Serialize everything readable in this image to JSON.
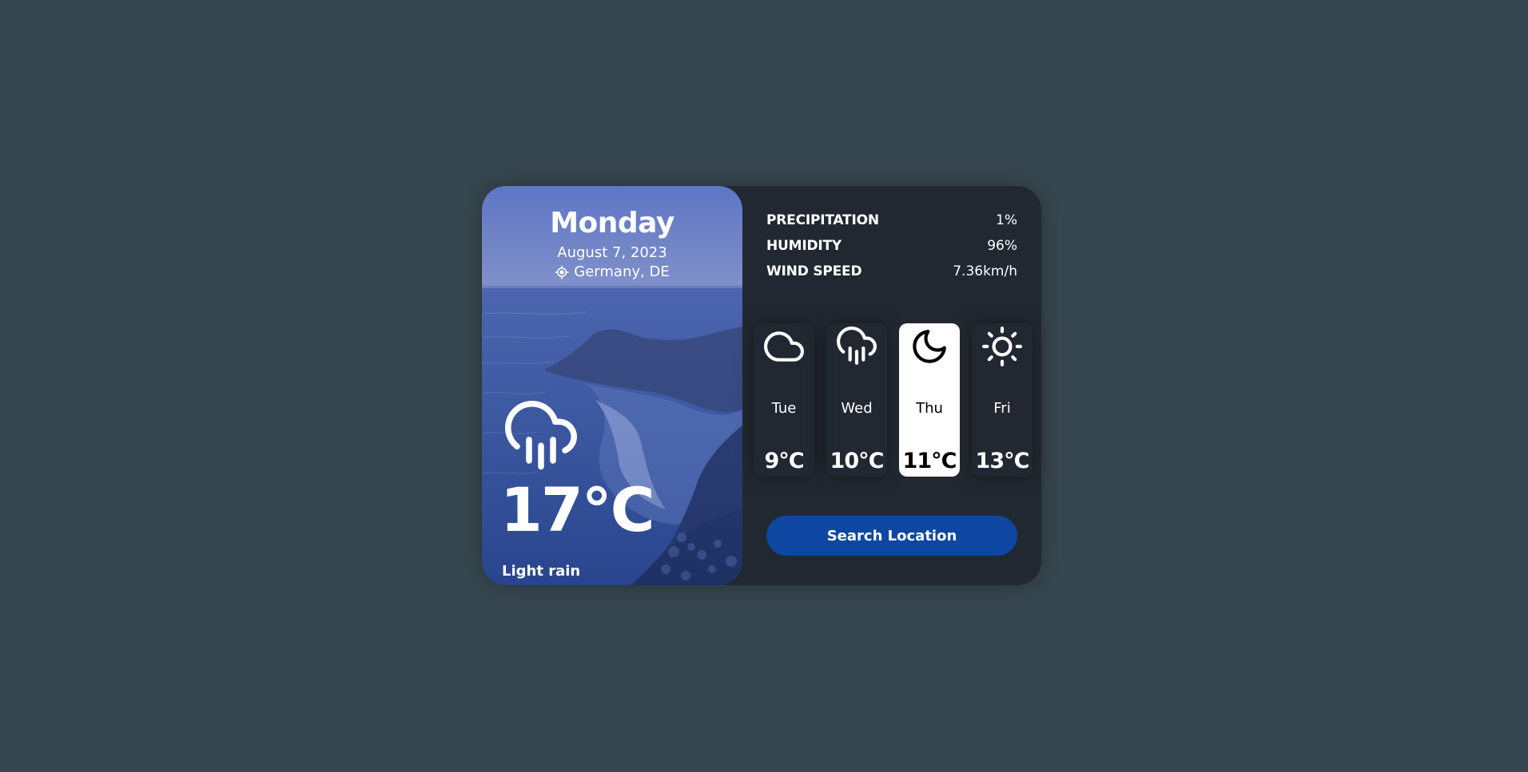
{
  "current": {
    "day": "Monday",
    "date": "August 7, 2023",
    "location": "Germany, DE",
    "location_icon": "location-crosshair-icon",
    "weather_icon": "cloud-rain-icon",
    "temperature": "17°C",
    "description": "Light rain"
  },
  "details": [
    {
      "name": "PRECIPITATION",
      "value": "1%"
    },
    {
      "name": "HUMIDITY",
      "value": "96%"
    },
    {
      "name": "WIND SPEED",
      "value": "7.36km/h"
    }
  ],
  "forecast": [
    {
      "day": "Tue",
      "temp": "9°C",
      "icon": "cloud-icon",
      "active": false
    },
    {
      "day": "Wed",
      "temp": "10°C",
      "icon": "cloud-rain-icon",
      "active": false
    },
    {
      "day": "Thu",
      "temp": "11°C",
      "icon": "moon-icon",
      "active": true
    },
    {
      "day": "Fri",
      "temp": "13°C",
      "icon": "sun-icon",
      "active": false
    }
  ],
  "search_button_label": "Search Location",
  "colors": {
    "page_background": "#37474f",
    "card_background": "#222831",
    "button": "#0d47a1",
    "active_day": "#ffffff"
  }
}
